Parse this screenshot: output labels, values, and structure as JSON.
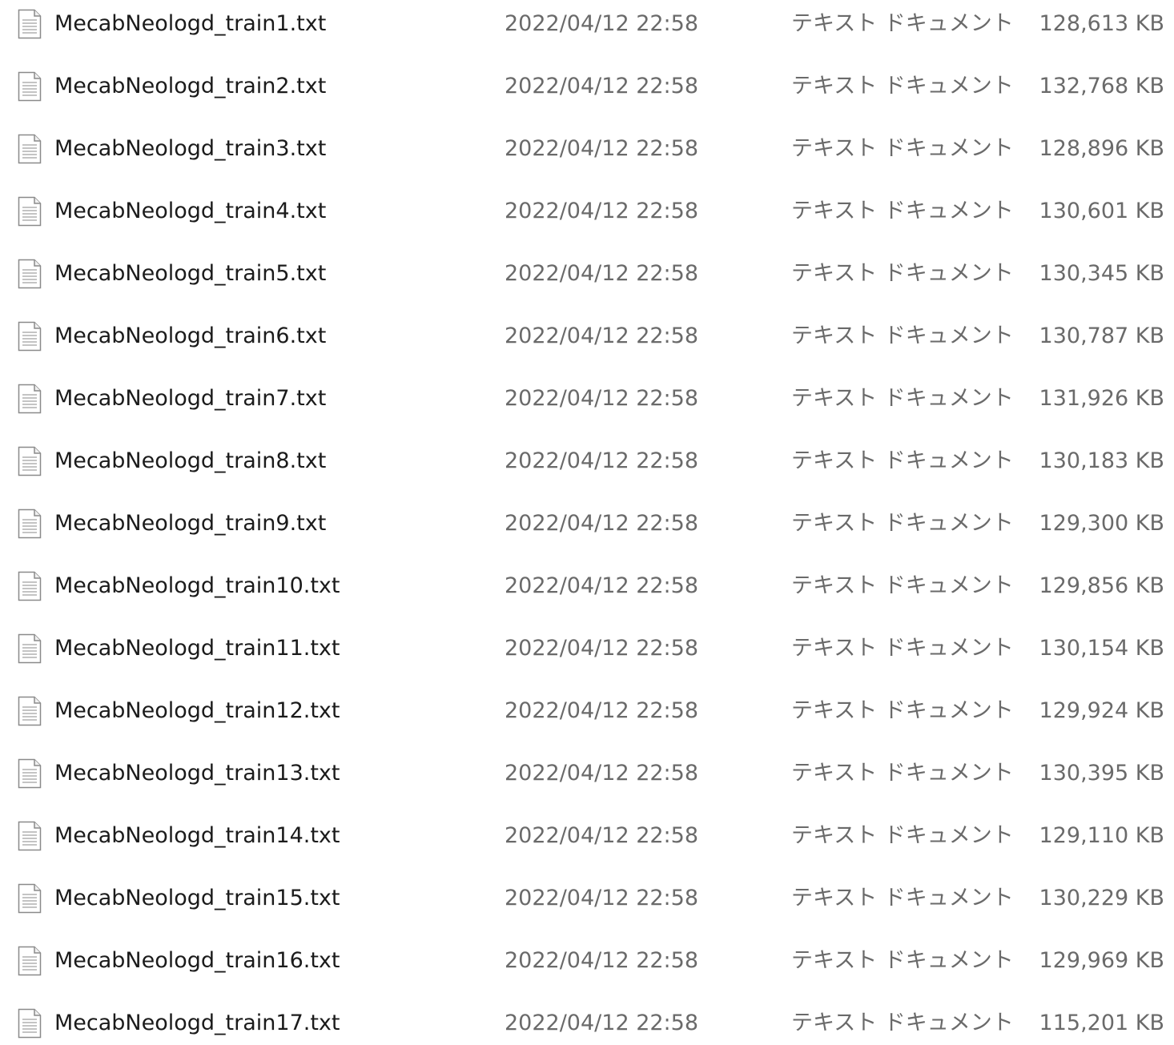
{
  "file_list": {
    "rows": [
      {
        "name": "MecabNeologd_train1.txt",
        "date": "2022/04/12 22:58",
        "type": "テキスト ドキュメント",
        "size": "128,613 KB",
        "icon": "text-document-icon"
      },
      {
        "name": "MecabNeologd_train2.txt",
        "date": "2022/04/12 22:58",
        "type": "テキスト ドキュメント",
        "size": "132,768 KB",
        "icon": "text-document-icon"
      },
      {
        "name": "MecabNeologd_train3.txt",
        "date": "2022/04/12 22:58",
        "type": "テキスト ドキュメント",
        "size": "128,896 KB",
        "icon": "text-document-icon"
      },
      {
        "name": "MecabNeologd_train4.txt",
        "date": "2022/04/12 22:58",
        "type": "テキスト ドキュメント",
        "size": "130,601 KB",
        "icon": "text-document-icon"
      },
      {
        "name": "MecabNeologd_train5.txt",
        "date": "2022/04/12 22:58",
        "type": "テキスト ドキュメント",
        "size": "130,345 KB",
        "icon": "text-document-icon"
      },
      {
        "name": "MecabNeologd_train6.txt",
        "date": "2022/04/12 22:58",
        "type": "テキスト ドキュメント",
        "size": "130,787 KB",
        "icon": "text-document-icon"
      },
      {
        "name": "MecabNeologd_train7.txt",
        "date": "2022/04/12 22:58",
        "type": "テキスト ドキュメント",
        "size": "131,926 KB",
        "icon": "text-document-icon"
      },
      {
        "name": "MecabNeologd_train8.txt",
        "date": "2022/04/12 22:58",
        "type": "テキスト ドキュメント",
        "size": "130,183 KB",
        "icon": "text-document-icon"
      },
      {
        "name": "MecabNeologd_train9.txt",
        "date": "2022/04/12 22:58",
        "type": "テキスト ドキュメント",
        "size": "129,300 KB",
        "icon": "text-document-icon"
      },
      {
        "name": "MecabNeologd_train10.txt",
        "date": "2022/04/12 22:58",
        "type": "テキスト ドキュメント",
        "size": "129,856 KB",
        "icon": "text-document-icon"
      },
      {
        "name": "MecabNeologd_train11.txt",
        "date": "2022/04/12 22:58",
        "type": "テキスト ドキュメント",
        "size": "130,154 KB",
        "icon": "text-document-icon"
      },
      {
        "name": "MecabNeologd_train12.txt",
        "date": "2022/04/12 22:58",
        "type": "テキスト ドキュメント",
        "size": "129,924 KB",
        "icon": "text-document-icon"
      },
      {
        "name": "MecabNeologd_train13.txt",
        "date": "2022/04/12 22:58",
        "type": "テキスト ドキュメント",
        "size": "130,395 KB",
        "icon": "text-document-icon"
      },
      {
        "name": "MecabNeologd_train14.txt",
        "date": "2022/04/12 22:58",
        "type": "テキスト ドキュメント",
        "size": "129,110 KB",
        "icon": "text-document-icon"
      },
      {
        "name": "MecabNeologd_train15.txt",
        "date": "2022/04/12 22:58",
        "type": "テキスト ドキュメント",
        "size": "130,229 KB",
        "icon": "text-document-icon"
      },
      {
        "name": "MecabNeologd_train16.txt",
        "date": "2022/04/12 22:58",
        "type": "テキスト ドキュメント",
        "size": "129,969 KB",
        "icon": "text-document-icon"
      },
      {
        "name": "MecabNeologd_train17.txt",
        "date": "2022/04/12 22:58",
        "type": "テキスト ドキュメント",
        "size": "115,201 KB",
        "icon": "text-document-icon"
      }
    ]
  }
}
